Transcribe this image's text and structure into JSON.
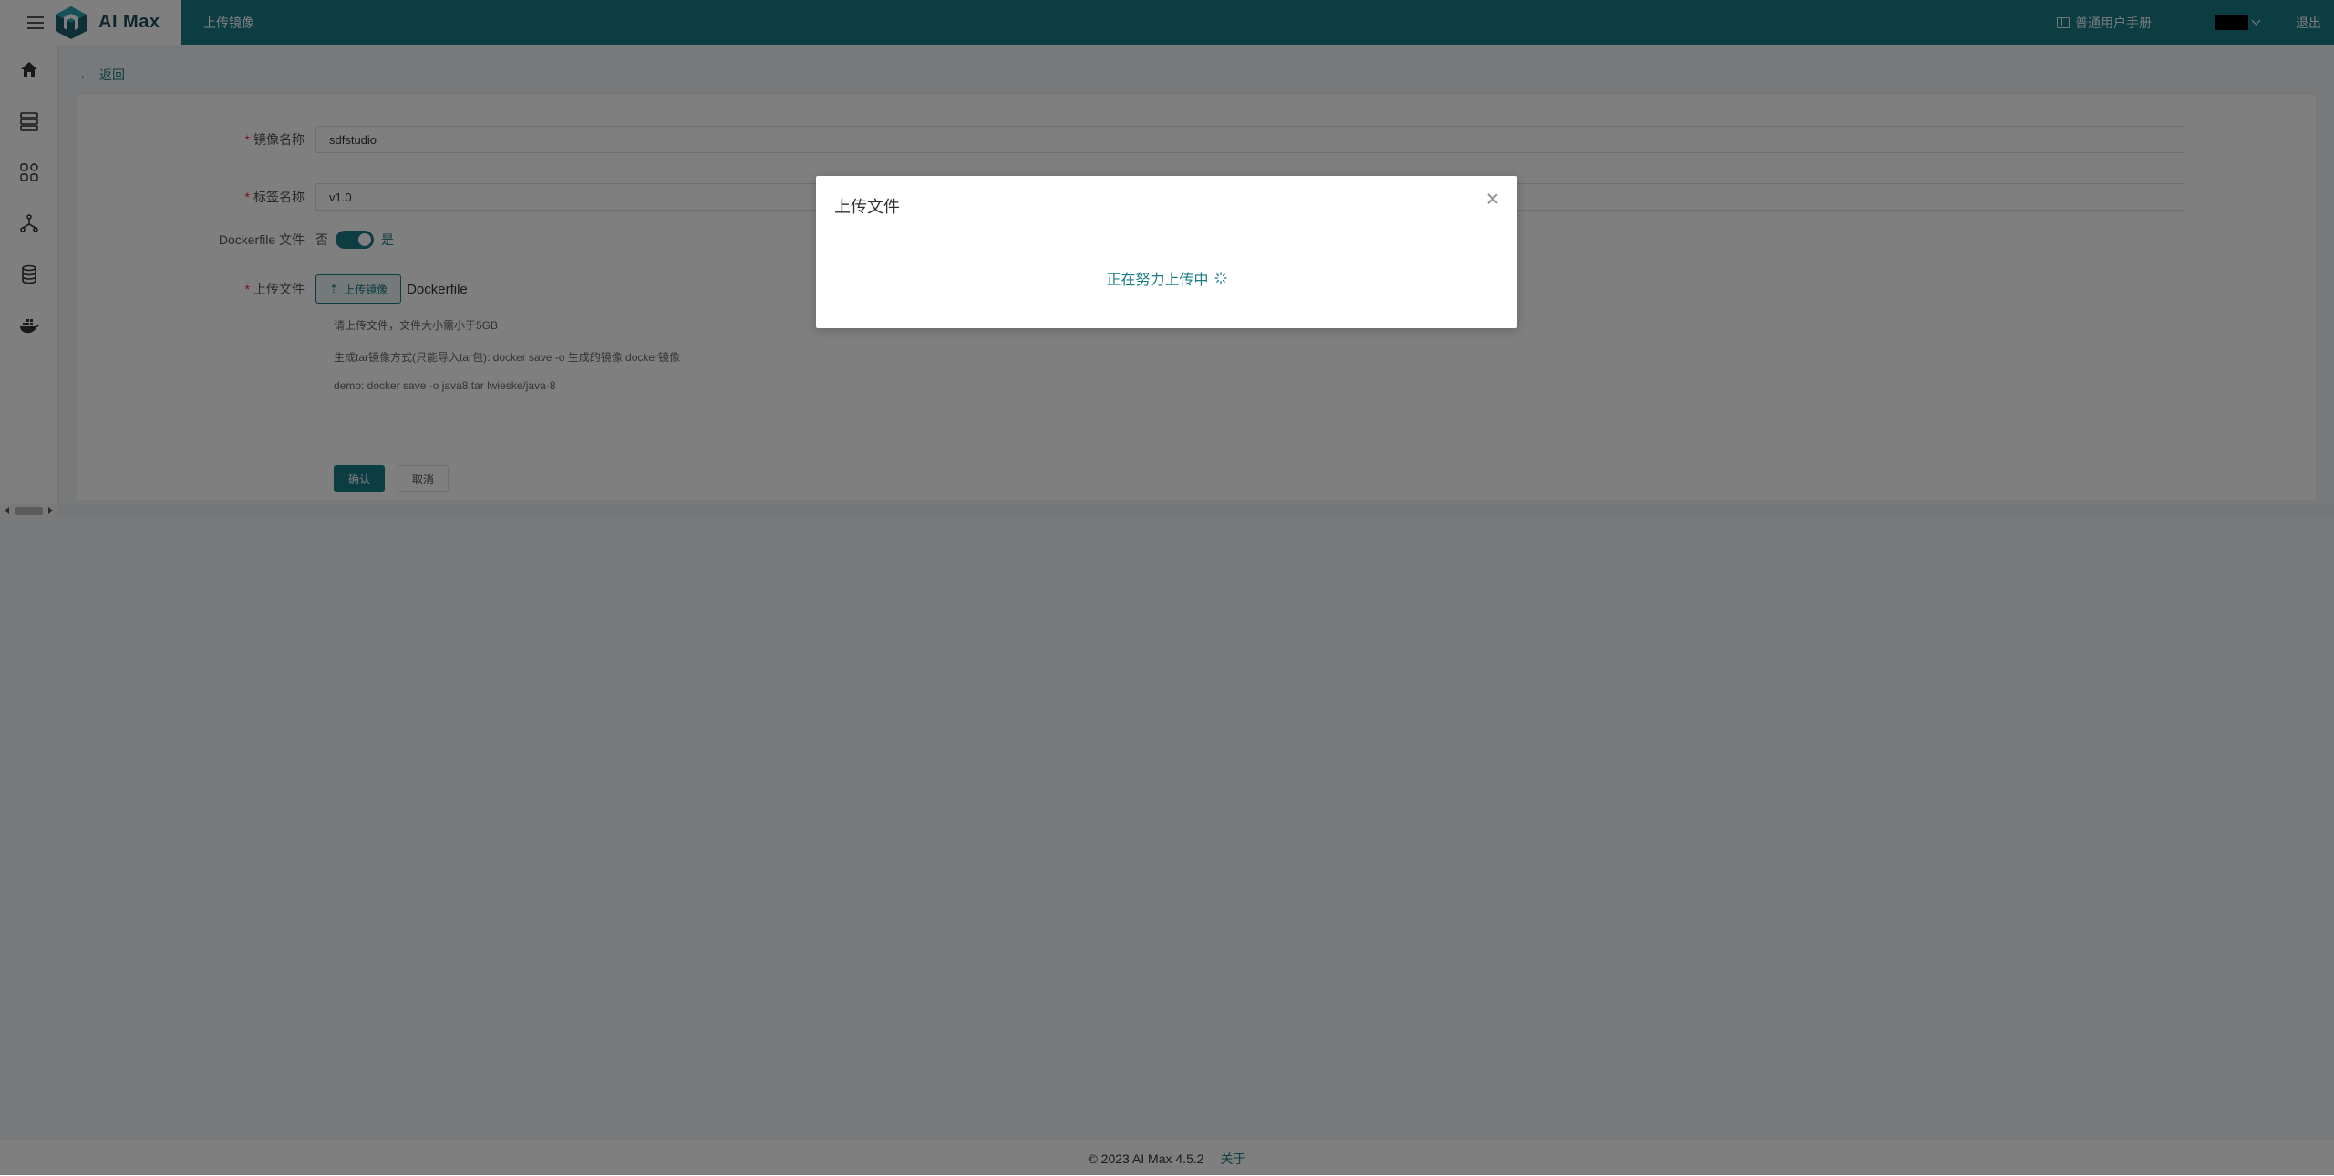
{
  "header": {
    "brand": "AI Max",
    "page_tab": "上传镜像",
    "manual_label": "普通用户手册",
    "logout_label": "退出"
  },
  "sidebar": {
    "icons": [
      "home-icon",
      "server-stack-icon",
      "apps-grid-icon",
      "network-icon",
      "database-icon",
      "docker-icon"
    ]
  },
  "page": {
    "back_label": "返回"
  },
  "form": {
    "image_name_label": "镜像名称",
    "image_name_value": "sdfstudio",
    "tag_name_label": "标签名称",
    "tag_name_value": "v1.0",
    "dockerfile_label": "Dockerfile 文件",
    "switch_off_label": "否",
    "switch_on_label": "是",
    "switch_on": true,
    "upload_label": "上传文件",
    "upload_button_label": "上传镜像",
    "upload_suffix": "Dockerfile",
    "hint_1": "请上传文件，文件大小需小于5GB",
    "hint_2": "生成tar镜像方式(只能导入tar包): docker save -o 生成的镜像 docker镜像",
    "hint_3": "demo: docker save -o java8.tar lwieske/java-8",
    "confirm_label": "确认",
    "cancel_label": "取消"
  },
  "dialog": {
    "title": "上传文件",
    "status_text": "正在努力上传中"
  },
  "footer": {
    "copyright": "© 2023 AI Max 4.5.2",
    "about_label": "关于"
  },
  "colors": {
    "primary": "#167b84",
    "mask": "rgba(0,0,0,0.5)"
  }
}
